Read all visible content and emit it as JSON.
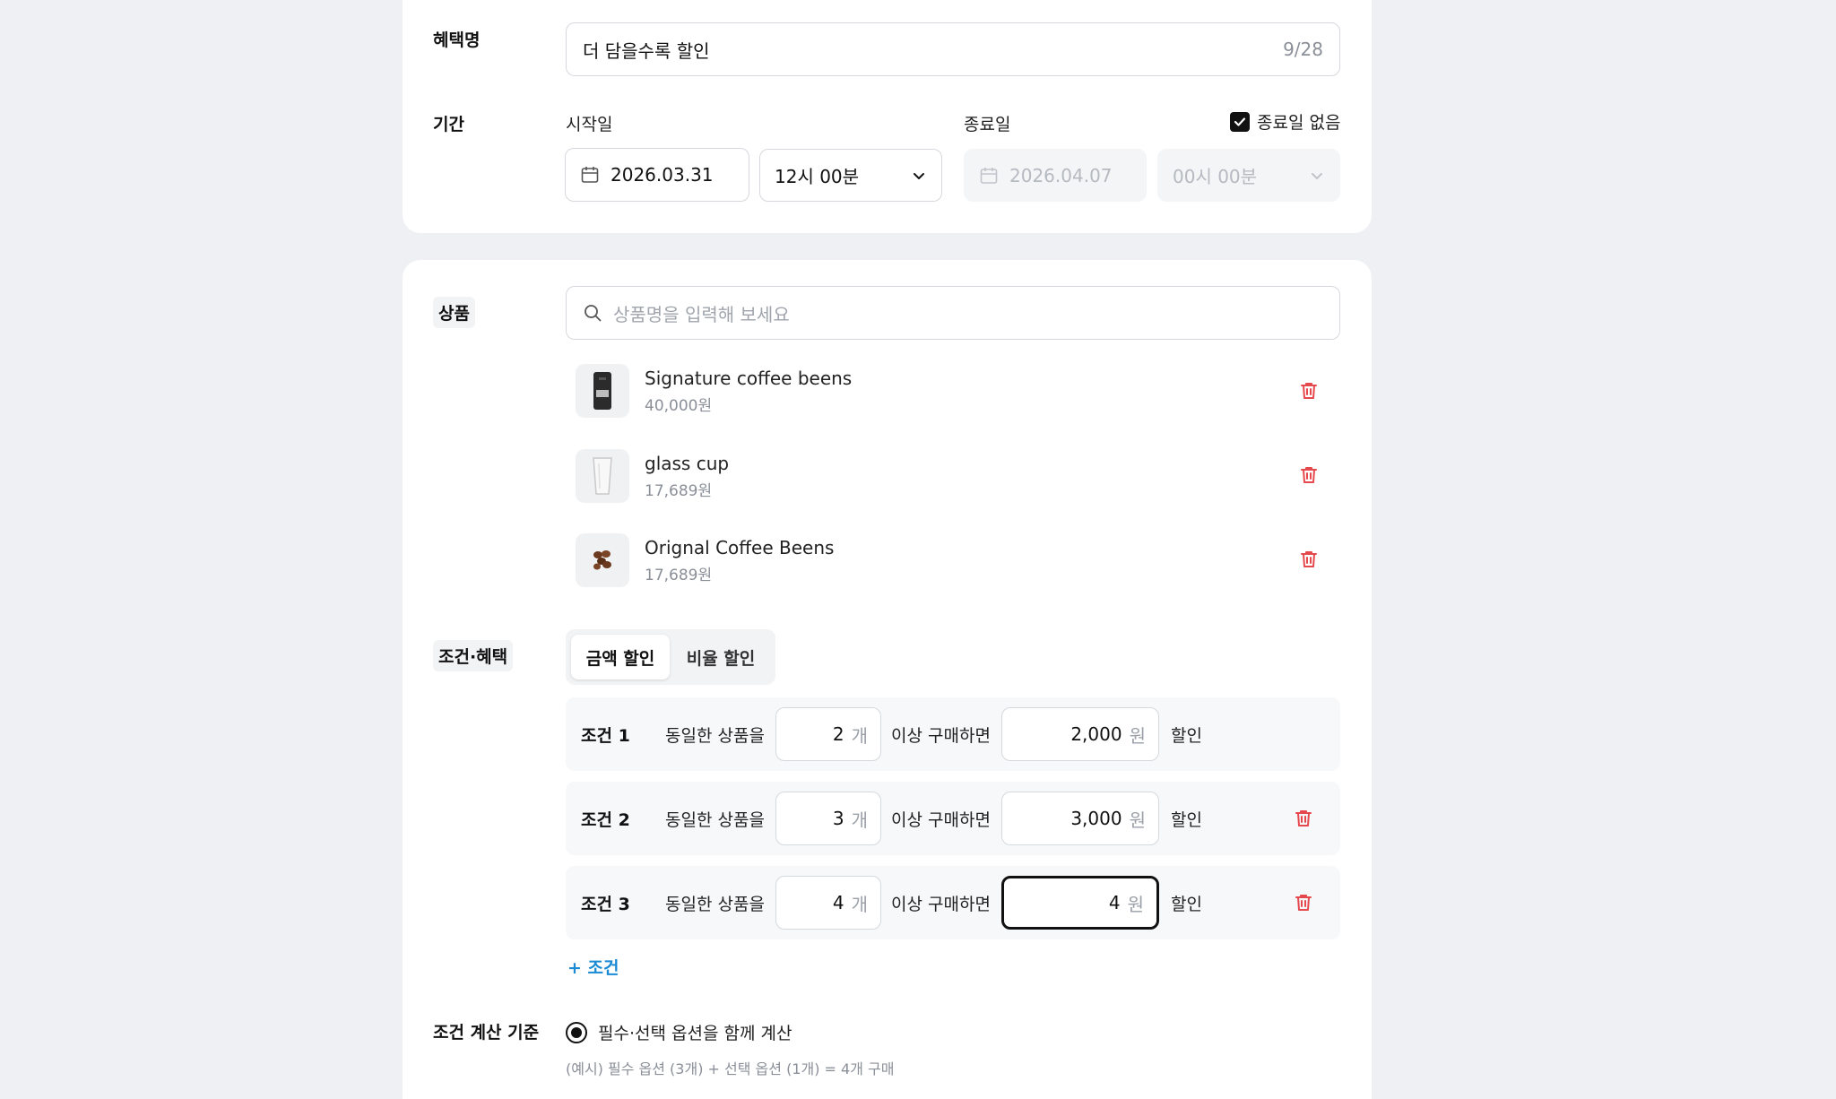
{
  "benefit": {
    "label": "혜택명",
    "name_value": "더 담을수록 할인",
    "char_count": "9/28"
  },
  "period": {
    "label": "기간",
    "start_label": "시작일",
    "start_date": "2026.03.31",
    "start_time": "12시 00분",
    "end_label": "종료일",
    "end_date": "2026.04.07",
    "end_time": "00시 00분",
    "no_end_label": "종료일 없음",
    "no_end_checked": true
  },
  "products": {
    "label": "상품",
    "search_placeholder": "상품명을 입력해 보세요",
    "items": [
      {
        "name": "Signature coffee beens",
        "price": "40,000원"
      },
      {
        "name": "glass cup",
        "price": "17,689원"
      },
      {
        "name": "Orignal Coffee Beens",
        "price": "17,689원"
      }
    ]
  },
  "conditions": {
    "label": "조건·혜택",
    "tabs": [
      "금액 할인",
      "비율 할인"
    ],
    "active_tab": 0,
    "rows": [
      {
        "title": "조건 1",
        "text1": "동일한 상품을",
        "qty": "2",
        "qty_unit": "개",
        "text2": "이상 구매하면",
        "amount": "2,000",
        "amount_unit": "원",
        "text3": "할인",
        "deletable": false
      },
      {
        "title": "조건 2",
        "text1": "동일한 상품을",
        "qty": "3",
        "qty_unit": "개",
        "text2": "이상 구매하면",
        "amount": "3,000",
        "amount_unit": "원",
        "text3": "할인",
        "deletable": true
      },
      {
        "title": "조건 3",
        "text1": "동일한 상품을",
        "qty": "4",
        "qty_unit": "개",
        "text2": "이상 구매하면",
        "amount": "4",
        "amount_unit": "원",
        "text3": "할인",
        "deletable": true
      }
    ],
    "add_label": "+ 조건"
  },
  "calc_basis": {
    "label": "조건 계산 기준",
    "option": "필수·선택 옵션을 함께 계산",
    "example": "(예시) 필수 옵션 (3개) + 선택 옵션 (1개) = 4개 구매"
  },
  "colors": {
    "accent": "#1a8ad4",
    "danger": "#e5484d",
    "background": "#eef0f3"
  }
}
